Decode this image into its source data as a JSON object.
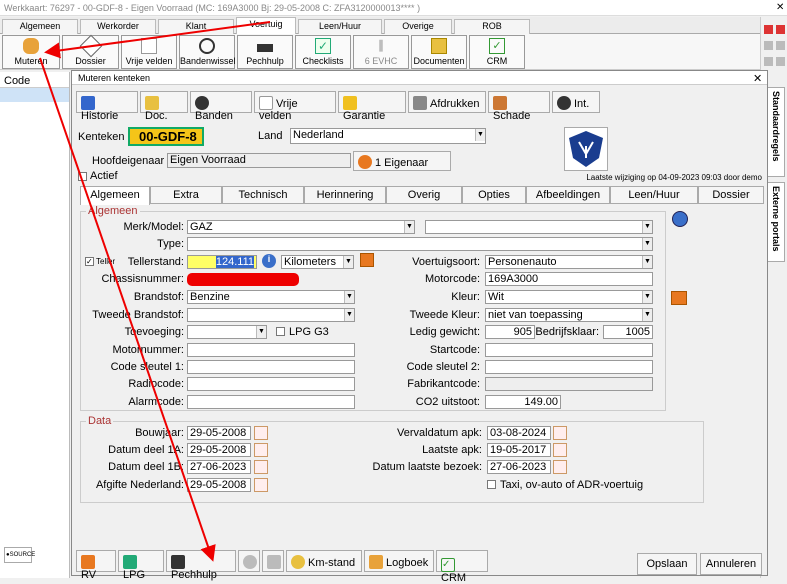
{
  "titlebar": "Werkkaart: 76297 - 00-GDF-8 - Eigen Voorraad (MC: 169A3000 Bj: 29-05-2008 C: ZFA3120000013**** )",
  "close_symbol": "✕",
  "main_tabs": [
    "Algemeen",
    "Werkorder",
    "Klant",
    "Voertuig",
    "Leen/Huur",
    "Overige",
    "ROB"
  ],
  "toolbar": [
    "Muteren",
    "Dossier",
    "Vrije velden",
    "Bandenwissel",
    "Pechhulp",
    "Checklists",
    "6 EVHC",
    "Documenten",
    "CRM"
  ],
  "left": {
    "header": "Code",
    "logo": "●SOURCE"
  },
  "right_tabs": [
    "Standaardregels",
    "Externe portals"
  ],
  "dialog": {
    "title": "Muteren kenteken",
    "close": "✕",
    "buttons": [
      "Historie",
      "Doc.",
      "Banden",
      "Vrije velden",
      "Garantie",
      "Afdrukken",
      "Schade",
      "Int."
    ],
    "kenteken_label": "Kenteken",
    "kenteken": "00-GDF-8",
    "land_label": "Land",
    "land": "Nederland",
    "hoofd_label": "Hoofdeigenaar",
    "hoofd": "Eigen Voorraad",
    "eigenaar_btn": "1 Eigenaar",
    "actief": "Actief",
    "laatste": "Laatste wijziging op 04-09-2023 09:03 door demo",
    "subtabs": [
      "Algemeen",
      "Extra",
      "Technisch",
      "Herinnering",
      "Overig",
      "Opties",
      "Afbeeldingen",
      "Leen/Huur",
      "Dossier"
    ],
    "algemeen_title": "Algemeen",
    "merk_label": "Merk/Model:",
    "merk": "GAZ",
    "model": "",
    "type_label": "Type:",
    "type": "",
    "teller_cb": "Teller",
    "tellerstand_label": "Tellerstand:",
    "tellerstand": "124.111",
    "eenheid": "Kilometers",
    "voertuigsoort_label": "Voertuigsoort:",
    "voertuigsoort": "Personenauto",
    "chassis_label": "Chassisnummer:",
    "motorcode_label": "Motorcode:",
    "motorcode": "169A3000",
    "brandstof_label": "Brandstof:",
    "brandstof": "Benzine",
    "kleur_label": "Kleur:",
    "kleur": "Wit",
    "tweede_brandstof_label": "Tweede Brandstof:",
    "tweede_brandstof": "",
    "tweede_kleur_label": "Tweede Kleur:",
    "tweede_kleur": "niet van toepassing",
    "toevoeging_label": "Toevoeging:",
    "toevoeging": "",
    "lpg_label": "LPG G3",
    "ledig_label": "Ledig gewicht:",
    "ledig": "905",
    "bedrijfsklaar_label": "Bedrijfsklaar:",
    "bedrijfsklaar": "1005",
    "motornummer_label": "Motornummer:",
    "startcode_label": "Startcode:",
    "code1_label": "Code sleutel 1:",
    "code2_label": "Code sleutel 2:",
    "radiocode_label": "Radiocode:",
    "fabrikantcode_label": "Fabrikantcode:",
    "alarmcode_label": "Alarmcode:",
    "co2_label": "CO2 uitstoot:",
    "co2": "149.00",
    "data_title": "Data",
    "bouwjaar_label": "Bouwjaar:",
    "bouwjaar": "29-05-2008",
    "deel1a_label": "Datum deel 1A:",
    "deel1a": "29-05-2008",
    "deel1b_label": "Datum deel 1B:",
    "deel1b": "27-06-2023",
    "afgifte_label": "Afgifte Nederland:",
    "afgifte": "29-05-2008",
    "vervaldatum_label": "Vervaldatum apk:",
    "vervaldatum": "03-08-2024",
    "laatste_apk_label": "Laatste apk:",
    "laatste_apk": "19-05-2017",
    "bezoek_label": "Datum laatste bezoek:",
    "bezoek": "27-06-2023",
    "taxi_label": "Taxi, ov-auto of ADR-voertuig",
    "bottom": [
      "RV",
      "LPG",
      "Pechhulp",
      "",
      "",
      "Km-stand",
      "Logboek",
      "CRM"
    ],
    "opslaan": "Opslaan",
    "annuleren": "Annuleren"
  }
}
